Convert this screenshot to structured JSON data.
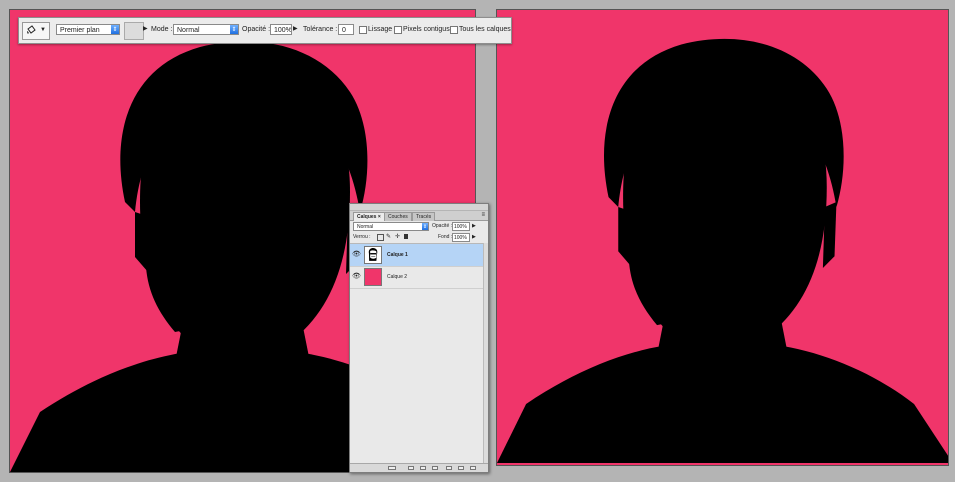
{
  "colors": {
    "background_pink": "#f0356a",
    "left_dark": "#000000",
    "left_light": "#ffffff",
    "right_dark": "#2b2a8c",
    "right_light": "#fff200",
    "right_glasses": "#f0356a",
    "selection_blue": "#b5d4f6",
    "dropdown_blue": "#1f6fe0"
  },
  "options_bar": {
    "tool_icon": "paint-bucket-icon",
    "fill_source": "Premier plan",
    "mode_label": "Mode :",
    "mode_value": "Normal",
    "opacity_label": "Opacité :",
    "opacity_value": "100%",
    "tolerance_label": "Tolérance :",
    "tolerance_value": "0",
    "smoothing_label": "Lissage",
    "contiguous_label": "Pixels contigus",
    "all_layers_label": "Tous les calques",
    "smoothing_checked": false,
    "contiguous_checked": false,
    "all_layers_checked": false
  },
  "layers_panel": {
    "tabs": [
      {
        "label": "Calques",
        "active": true,
        "close": "×"
      },
      {
        "label": "Couches",
        "active": false
      },
      {
        "label": "Tracés",
        "active": false
      }
    ],
    "blend_mode": "Normal",
    "opacity_label": "Opacité :",
    "opacity_value": "100%",
    "lock_label": "Verrou :",
    "fill_label": "Fond :",
    "fill_value": "100%",
    "layers": [
      {
        "name": "Calque 1",
        "visible": true,
        "selected": true,
        "thumbnail": "portrait-thumbnail"
      },
      {
        "name": "Calque 2",
        "visible": true,
        "selected": false,
        "thumbnail": "pink-fill-thumbnail"
      }
    ]
  }
}
